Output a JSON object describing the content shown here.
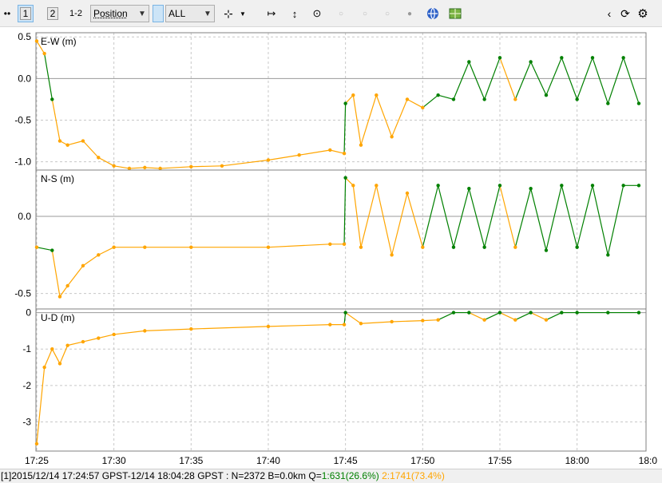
{
  "toolbar": {
    "btn1": "1",
    "btn2": "2",
    "btn12": "1-2",
    "plot_type": "Position",
    "satellite": "ALL"
  },
  "plots": [
    {
      "label": "E-W (m)",
      "ylim": [
        -1.1,
        0.55
      ],
      "ticks": [
        0.5,
        0.0,
        -0.5,
        -1.0
      ],
      "tick_labels": [
        "0.5",
        "0.0",
        "-0.5",
        "-1.0"
      ]
    },
    {
      "label": "N-S (m)",
      "ylim": [
        -0.6,
        0.3
      ],
      "ticks": [
        0.0,
        -0.5
      ],
      "tick_labels": [
        "0.0",
        "-0.5"
      ]
    },
    {
      "label": "U-D (m)",
      "ylim": [
        -3.8,
        0.1
      ],
      "ticks": [
        0,
        -1,
        -2,
        -3
      ],
      "tick_labels": [
        "0",
        "-1",
        "-2",
        "-3"
      ]
    }
  ],
  "x_axis": {
    "tick_labels": [
      "17:25",
      "17:30",
      "17:35",
      "17:40",
      "17:45",
      "17:50",
      "17:55",
      "18:00",
      "18:0"
    ]
  },
  "status": {
    "prefix": "[1]2015/12/14 17:24:57 GPST-12/14 18:04:28 GPST : N=2372 B=0.0km Q=",
    "q1": "1:631(26.6%)",
    "q2": "2:1741(73.4%)"
  },
  "colors": {
    "q1": "#008000",
    "q2": "#ffa500",
    "grid": "#c8c8c8"
  },
  "chart_data": [
    {
      "type": "scatter",
      "ylabel": "E-W (m)",
      "xlim": [
        "17:24:57",
        "18:04:28"
      ],
      "ylim": [
        -1.1,
        0.55
      ],
      "grid": true,
      "x": [
        "17:25",
        "17:25:30",
        "17:26",
        "17:26:30",
        "17:27",
        "17:28",
        "17:29",
        "17:30",
        "17:31",
        "17:32",
        "17:33",
        "17:35",
        "17:37",
        "17:40",
        "17:42",
        "17:44",
        "17:44:55",
        "17:45",
        "17:45:30",
        "17:46",
        "17:47",
        "17:48",
        "17:49",
        "17:50",
        "17:51",
        "17:52",
        "17:53",
        "17:54",
        "17:55",
        "17:56",
        "17:57",
        "17:58",
        "17:59",
        "18:00",
        "18:01",
        "18:02",
        "18:03",
        "18:04"
      ],
      "y": [
        0.45,
        0.3,
        -0.25,
        -0.75,
        -0.8,
        -0.75,
        -0.95,
        -1.05,
        -1.08,
        -1.07,
        -1.08,
        -1.06,
        -1.05,
        -0.98,
        -0.92,
        -0.86,
        -0.9,
        -0.3,
        -0.2,
        -0.8,
        -0.2,
        -0.7,
        -0.25,
        -0.35,
        -0.2,
        -0.25,
        0.2,
        -0.25,
        0.25,
        -0.25,
        0.2,
        -0.2,
        0.25,
        -0.25,
        0.25,
        -0.3,
        0.25,
        -0.3
      ],
      "q": [
        2,
        2,
        1,
        2,
        2,
        2,
        2,
        2,
        2,
        2,
        2,
        2,
        2,
        2,
        2,
        2,
        2,
        1,
        2,
        2,
        2,
        2,
        2,
        2,
        1,
        1,
        1,
        1,
        1,
        2,
        1,
        1,
        1,
        1,
        1,
        1,
        1,
        1
      ]
    },
    {
      "type": "scatter",
      "ylabel": "N-S (m)",
      "xlim": [
        "17:24:57",
        "18:04:28"
      ],
      "ylim": [
        -0.6,
        0.3
      ],
      "grid": true,
      "x": [
        "17:25",
        "17:26",
        "17:26:30",
        "17:27",
        "17:28",
        "17:29",
        "17:30",
        "17:32",
        "17:35",
        "17:40",
        "17:44",
        "17:44:55",
        "17:45",
        "17:45:30",
        "17:46",
        "17:47",
        "17:48",
        "17:49",
        "17:50",
        "17:51",
        "17:52",
        "17:53",
        "17:54",
        "17:55",
        "17:56",
        "17:57",
        "17:58",
        "17:59",
        "18:00",
        "18:01",
        "18:02",
        "18:03",
        "18:04"
      ],
      "y": [
        -0.2,
        -0.22,
        -0.52,
        -0.45,
        -0.32,
        -0.25,
        -0.2,
        -0.2,
        -0.2,
        -0.2,
        -0.18,
        -0.18,
        0.25,
        0.2,
        -0.2,
        0.2,
        -0.25,
        0.15,
        -0.2,
        0.2,
        -0.2,
        0.18,
        -0.2,
        0.2,
        -0.2,
        0.18,
        -0.22,
        0.2,
        -0.2,
        0.2,
        -0.25,
        0.2,
        0.2
      ],
      "q": [
        2,
        1,
        2,
        2,
        2,
        2,
        2,
        2,
        2,
        2,
        2,
        2,
        1,
        2,
        2,
        2,
        2,
        2,
        2,
        1,
        1,
        1,
        1,
        1,
        2,
        1,
        1,
        1,
        1,
        1,
        1,
        1,
        1
      ]
    },
    {
      "type": "scatter",
      "ylabel": "U-D (m)",
      "xlim": [
        "17:24:57",
        "18:04:28"
      ],
      "ylim": [
        -3.8,
        0.1
      ],
      "grid": true,
      "x": [
        "17:25",
        "17:25:30",
        "17:26",
        "17:26:30",
        "17:27",
        "17:28",
        "17:29",
        "17:30",
        "17:32",
        "17:35",
        "17:40",
        "17:44",
        "17:44:55",
        "17:45",
        "17:46",
        "17:48",
        "17:50",
        "17:51",
        "17:52",
        "17:53",
        "17:54",
        "17:55",
        "17:56",
        "17:57",
        "17:58",
        "17:59",
        "18:00",
        "18:02",
        "18:04"
      ],
      "y": [
        -3.6,
        -1.5,
        -1.0,
        -1.4,
        -0.9,
        -0.8,
        -0.7,
        -0.6,
        -0.5,
        -0.45,
        -0.38,
        -0.33,
        -0.33,
        0.0,
        -0.3,
        -0.25,
        -0.22,
        -0.2,
        0.0,
        0.0,
        -0.2,
        0.0,
        -0.2,
        0.0,
        -0.2,
        0.0,
        0.0,
        0.0,
        0.0
      ],
      "q": [
        2,
        2,
        2,
        2,
        2,
        2,
        2,
        2,
        2,
        2,
        2,
        2,
        2,
        1,
        2,
        2,
        2,
        2,
        1,
        1,
        2,
        1,
        2,
        1,
        2,
        1,
        1,
        1,
        1
      ]
    }
  ]
}
